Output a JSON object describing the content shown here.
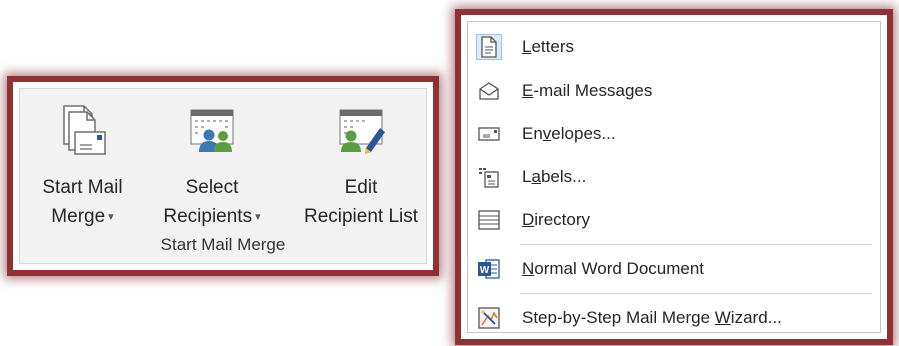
{
  "ribbon": {
    "buttons": [
      {
        "line1": "Start Mail",
        "line2": "Merge",
        "has_dropdown": true,
        "icon": "start-mail-merge-icon"
      },
      {
        "line1": "Select",
        "line2": "Recipients",
        "has_dropdown": true,
        "icon": "select-recipients-icon"
      },
      {
        "line1": "Edit",
        "line2": "Recipient List",
        "has_dropdown": false,
        "icon": "edit-recipient-list-icon"
      }
    ],
    "dropdown_caret": "▾",
    "group_label": "Start Mail Merge"
  },
  "menu": {
    "items": [
      {
        "pre": "",
        "key": "L",
        "post": "etters",
        "icon": "letter-document-icon",
        "selected": true
      },
      {
        "pre": "",
        "key": "E",
        "post": "-mail Messages",
        "icon": "email-envelope-icon",
        "selected": false
      },
      {
        "pre": "En",
        "key": "v",
        "post": "elopes...",
        "icon": "envelope-icon",
        "selected": false
      },
      {
        "pre": "L",
        "key": "a",
        "post": "bels...",
        "icon": "labels-icon",
        "selected": false
      },
      {
        "pre": "",
        "key": "D",
        "post": "irectory",
        "icon": "directory-list-icon",
        "selected": false
      },
      {
        "pre": "",
        "key": "N",
        "post": "ormal Word Document",
        "icon": "word-document-icon",
        "selected": false
      },
      {
        "pre": "Step-by-Step Mail Merge ",
        "key": "W",
        "post": "izard...",
        "icon": "wizard-icon",
        "selected": false
      }
    ]
  },
  "colors": {
    "frame_border": "#8f3236",
    "word_blue": "#2b579a",
    "people_green": "#5b9e3f",
    "people_blue": "#3c78b4"
  }
}
